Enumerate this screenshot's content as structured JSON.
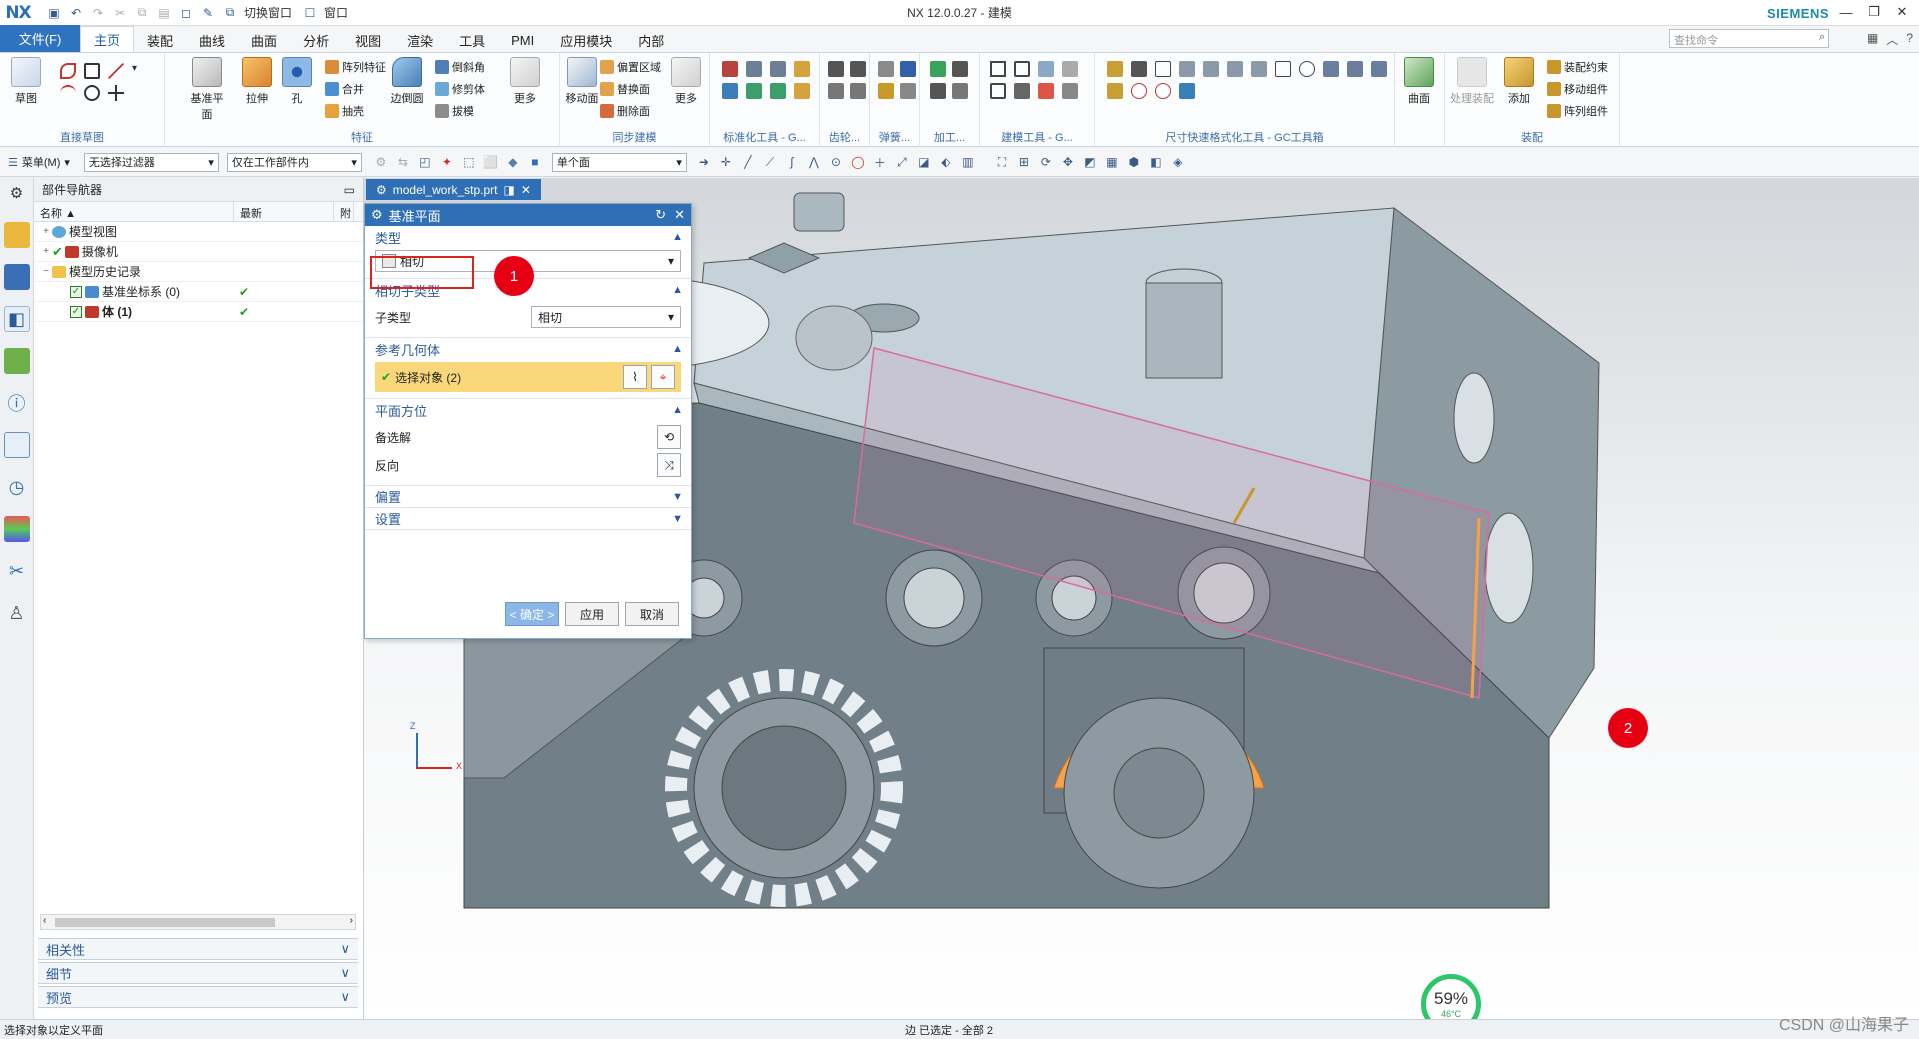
{
  "window": {
    "logo": "NX",
    "title": "NX 12.0.0.27 - 建模",
    "brand": "SIEMENS",
    "quick_access": {
      "switch_window": "切换窗口",
      "window": "窗口"
    }
  },
  "ribbon_tabs": {
    "file": "文件(F)",
    "tabs": [
      "主页",
      "装配",
      "曲线",
      "曲面",
      "分析",
      "视图",
      "渲染",
      "工具",
      "PMI",
      "应用模块",
      "内部"
    ],
    "active": "主页",
    "search_placeholder": "查找命令"
  },
  "ribbon": {
    "sketch": {
      "label": "草图",
      "group": "直接草图"
    },
    "feature": {
      "datum_plane": "基准平面",
      "extrude": "拉伸",
      "hole": "孔",
      "pattern": "阵列特征",
      "unite": "合并",
      "shell": "抽壳",
      "edge_blend": "边倒圆",
      "chamfer": "倒斜角",
      "trim_body": "修剪体",
      "draft": "拔模",
      "more": "更多",
      "group": "特征"
    },
    "sync": {
      "move_face": "移动面",
      "offset_region": "偏置区域",
      "replace_face": "替换面",
      "delete_face": "删除面",
      "more": "更多",
      "group": "同步建模"
    },
    "group_labels": [
      "标准化工具 - G...",
      "齿轮...",
      "弹簧...",
      "加工...",
      "建模工具 - G...",
      "尺寸快速格式化工具 - GC工具箱"
    ],
    "surface": {
      "label": "曲面"
    },
    "assembly": {
      "process_assembly": "处理装配",
      "add": "添加",
      "constraint": "装配约束",
      "move_component": "移动组件",
      "pattern_component": "阵列组件",
      "group": "装配"
    }
  },
  "toolbar2": {
    "menu": "菜单(M)",
    "filter": "无选择过滤器",
    "scope": "仅在工作部件内",
    "face_rule": "单个面"
  },
  "navigator": {
    "title": "部件导航器",
    "col_name": "名称",
    "col_latest": "最新",
    "col_extra": "附",
    "items": [
      {
        "label": "模型视图",
        "indent": 0
      },
      {
        "label": "摄像机",
        "indent": 0
      },
      {
        "label": "模型历史记录",
        "indent": 0
      },
      {
        "label": "基准坐标系 (0)",
        "indent": 1
      },
      {
        "label": "体 (1)",
        "indent": 1
      }
    ],
    "sections": [
      "相关性",
      "细节",
      "预览"
    ]
  },
  "document_tab": "model_work_stp.prt",
  "dialog": {
    "title": "基准平面",
    "type_section": "类型",
    "type_value": "相切",
    "subtype_section": "相切子类型",
    "subtype_label": "子类型",
    "subtype_value": "相切",
    "ref_section": "参考几何体",
    "select_object": "选择对象 (2)",
    "orientation_section": "平面方位",
    "alternate": "备选解",
    "reverse": "反向",
    "offset_section": "偏置",
    "settings_section": "设置",
    "ok": "< 确定 >",
    "apply": "应用",
    "cancel": "取消"
  },
  "annotations": {
    "badge1": "1",
    "badge2": "2"
  },
  "triad": {
    "z": "Z",
    "x": "X"
  },
  "gauge": {
    "percent": "59%",
    "temp": "46°C"
  },
  "status": {
    "message": "选择对象以定义平面",
    "selection": "边 已选定 - 全部 2",
    "watermark": "CSDN @山海果子"
  },
  "colors": {
    "accent": "#2f6fb5",
    "part": "#6f7f87",
    "plane": "#d96b9d",
    "highlight": "#f7a24a",
    "badge": "#e60012"
  }
}
